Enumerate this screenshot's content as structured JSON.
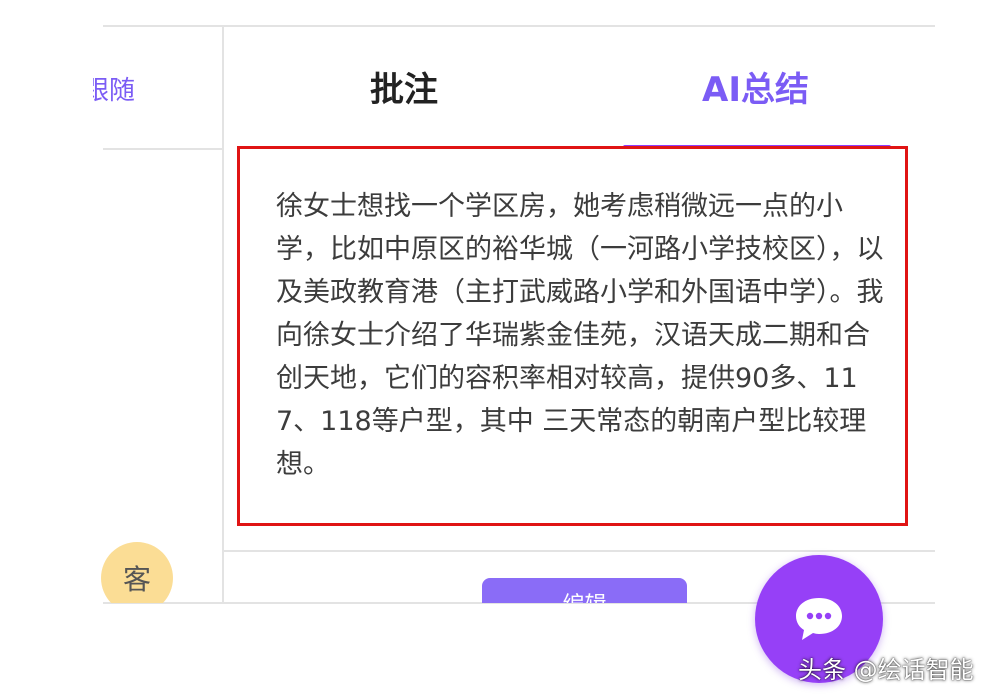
{
  "left_panel": {
    "label": "跟随",
    "avatar_text": "客"
  },
  "tabs": [
    {
      "label": "批注",
      "active": false
    },
    {
      "label": "AI总结",
      "active": true
    }
  ],
  "summary": {
    "text": "徐女士想找一个学区房，她考虑稍微远一点的小学，比如中原区的裕华城（一河路小学技校区），以及美政教育港（主打武威路小学和外国语中学）。我向徐女士介绍了华瑞紫金佳苑，汉语天成二期和合创天地，它们的容积率相对较高，提供90多、117、118等户型，其中 三天常态的朝南户型比较理想。"
  },
  "bottom_button": {
    "label": "编辑"
  },
  "chat_fab": {
    "icon": "chat-bubble-icon"
  },
  "watermark": "头条 @绘话智能",
  "colors": {
    "accent": "#7b5cf5",
    "tab_underline": "#8f3dfa",
    "highlight_border": "#e01414",
    "fab": "#9640f7",
    "avatar_bg": "#fbdd95"
  }
}
